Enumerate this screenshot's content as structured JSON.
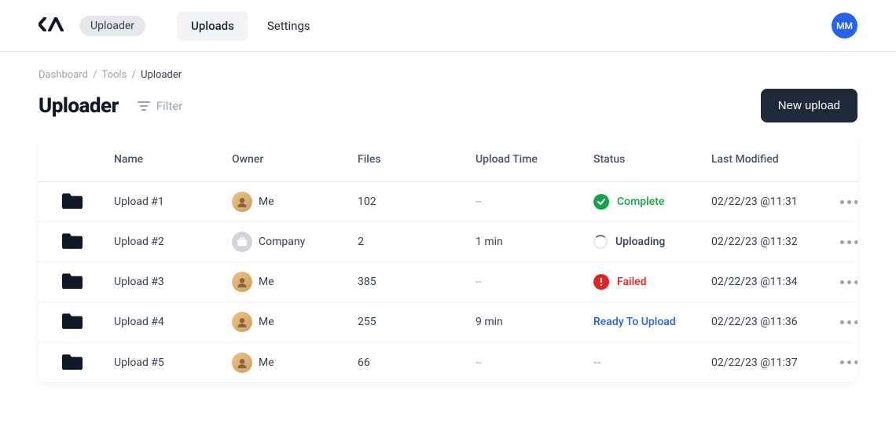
{
  "header": {
    "logo_text": "CA",
    "app_pill": "Uploader",
    "nav": [
      {
        "label": "Uploads",
        "active": true
      },
      {
        "label": "Settings",
        "active": false
      }
    ],
    "avatar_initials": "MM"
  },
  "breadcrumb": {
    "items": [
      "Dashboard",
      "Tools",
      "Uploader"
    ]
  },
  "title_row": {
    "page_title": "Uploader",
    "filter_label": "Filter",
    "new_upload_label": "New upload"
  },
  "table": {
    "headers": {
      "name": "Name",
      "owner": "Owner",
      "files": "Files",
      "upload_time": "Upload Time",
      "status": "Status",
      "last_modified": "Last Modified"
    },
    "rows": [
      {
        "name": "Upload #1",
        "owner": {
          "label": "Me",
          "kind": "person"
        },
        "files": "102",
        "upload_time": "--",
        "status": {
          "kind": "complete",
          "label": "Complete"
        },
        "last_modified": "02/22/23 @11:31"
      },
      {
        "name": "Upload #2",
        "owner": {
          "label": "Company",
          "kind": "company"
        },
        "files": "2",
        "upload_time": "1 min",
        "status": {
          "kind": "uploading",
          "label": "Uploading"
        },
        "last_modified": "02/22/23 @11:32"
      },
      {
        "name": "Upload #3",
        "owner": {
          "label": "Me",
          "kind": "person"
        },
        "files": "385",
        "upload_time": "--",
        "status": {
          "kind": "failed",
          "label": "Failed"
        },
        "last_modified": "02/22/23 @11:34"
      },
      {
        "name": "Upload #4",
        "owner": {
          "label": "Me",
          "kind": "person"
        },
        "files": "255",
        "upload_time": "9 min",
        "status": {
          "kind": "ready",
          "label": "Ready To Upload"
        },
        "last_modified": "02/22/23 @11:36"
      },
      {
        "name": "Upload #5",
        "owner": {
          "label": "Me",
          "kind": "person"
        },
        "files": "66",
        "upload_time": "--",
        "status": {
          "kind": "none",
          "label": "--"
        },
        "last_modified": "02/22/23 @11:37"
      }
    ]
  }
}
